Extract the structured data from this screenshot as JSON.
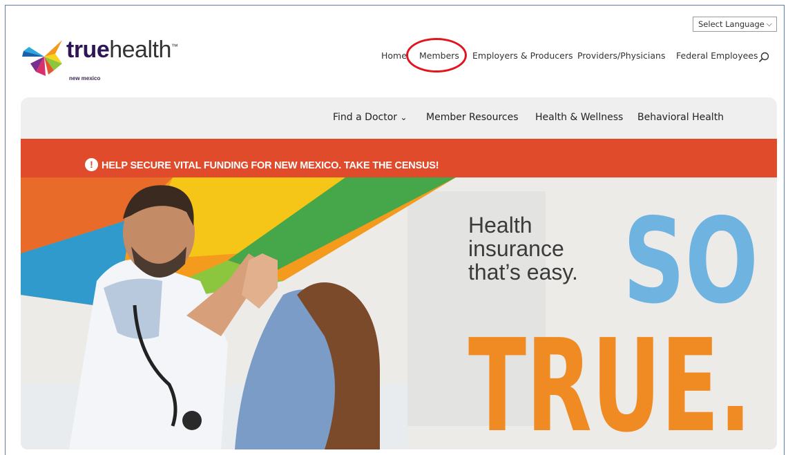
{
  "language_select": {
    "value": "Select Language",
    "icon": "chevron-down-icon"
  },
  "logo": {
    "brand_bold": "true",
    "brand_light": "health",
    "trademark": "™",
    "subtitle": "new mexico"
  },
  "top_nav": {
    "items": [
      "Home",
      "Members",
      "Employers & Producers",
      "Providers/Physicians",
      "Federal Employees"
    ],
    "search_icon": "search-icon"
  },
  "secondary_nav": {
    "items": [
      "Find a Doctor",
      "Member Resources",
      "Health & Wellness",
      "Behavioral Health"
    ],
    "dropdown_caret": "⌄"
  },
  "alert": {
    "icon": "!",
    "text": "HELP SECURE VITAL FUNDING FOR NEW MEXICO. TAKE THE CENSUS!"
  },
  "hero": {
    "tagline": [
      "Health",
      "insurance",
      "that’s easy."
    ],
    "big_word_1": "SO",
    "big_word_2": "TRUE."
  },
  "colors": {
    "brand_purple": "#2f1656",
    "alert_red": "#e04b2c",
    "highlight_circle": "#e2141d",
    "so_blue": "#6fb3e0"
  }
}
